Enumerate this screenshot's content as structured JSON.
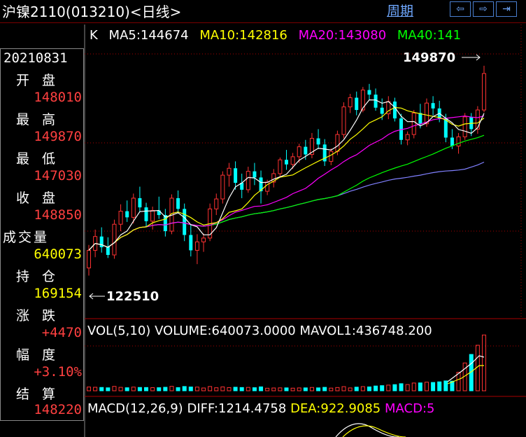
{
  "header": {
    "title": "沪镍2110(013210)<日线>",
    "period_link": "周期",
    "nav_left": "⇦",
    "nav_right": "⇨",
    "nav_end": "⇥"
  },
  "info_panel": {
    "date": "20210831",
    "items": [
      {
        "label": "开盘",
        "value": "148010",
        "color": "#ff4040"
      },
      {
        "label": "最高",
        "value": "149870",
        "color": "#ff4040"
      },
      {
        "label": "最低",
        "value": "147030",
        "color": "#ff4040"
      },
      {
        "label": "收盘",
        "value": "148850",
        "color": "#ff4040"
      },
      {
        "label": "成交量",
        "value": "640073",
        "color": "#ffff00"
      },
      {
        "label": "持仓",
        "value": "169154",
        "color": "#ffff00"
      },
      {
        "label": "涨跌",
        "value": "+4470",
        "color": "#ff4040"
      },
      {
        "label": "幅度",
        "value": "+3.10%",
        "color": "#ff4040"
      },
      {
        "label": "结算",
        "value": "148220",
        "color": "#ff4040"
      }
    ]
  },
  "ma_legend": {
    "k": "K",
    "ma5": "MA5:144674",
    "ma10": "MA10:142816",
    "ma20": "MA20:143080",
    "ma40": "MA40:141",
    "colors": {
      "ma5": "#ffffff",
      "ma10": "#ffff00",
      "ma20": "#ff00ff",
      "ma40": "#00ff00",
      "ma60": "#8080ff"
    }
  },
  "annotations": {
    "high": "149870",
    "low": "122510"
  },
  "volume_legend": {
    "name": "VOL(5,10)",
    "volume": "VOLUME:640073.0000",
    "mavol1": "MAVOL1:436748.200"
  },
  "macd_legend": {
    "name": "MACD(12,26,9)",
    "diff": "DIFF:1214.4758",
    "dea": "DEA:922.9085",
    "macd": "MACD:5"
  },
  "chart_data": {
    "type": "candlestick",
    "price_range": [
      121000,
      151500
    ],
    "candles": [
      [
        123500,
        126500,
        122510,
        125800
      ],
      [
        125800,
        128500,
        124900,
        127600
      ],
      [
        127600,
        128800,
        125500,
        126200
      ],
      [
        126300,
        127500,
        124800,
        125200
      ],
      [
        125200,
        129800,
        124700,
        129200
      ],
      [
        129200,
        131800,
        128300,
        130900
      ],
      [
        130900,
        132300,
        129500,
        130100
      ],
      [
        130100,
        133200,
        129300,
        132600
      ],
      [
        132600,
        134100,
        130800,
        131400
      ],
      [
        131400,
        132000,
        128800,
        129600
      ],
      [
        129600,
        131500,
        128500,
        131000
      ],
      [
        131000,
        132800,
        129900,
        130400
      ],
      [
        130400,
        131200,
        127600,
        128300
      ],
      [
        128300,
        133100,
        127900,
        132600
      ],
      [
        132600,
        133600,
        130600,
        131200
      ],
      [
        131200,
        131900,
        127000,
        127800
      ],
      [
        127800,
        129100,
        125000,
        125800
      ],
      [
        125800,
        127900,
        124000,
        126900
      ],
      [
        126900,
        128000,
        125600,
        127400
      ],
      [
        127400,
        131900,
        127000,
        131200
      ],
      [
        131200,
        133200,
        130400,
        132500
      ],
      [
        132500,
        136100,
        131900,
        135600
      ],
      [
        135600,
        137200,
        134100,
        136500
      ],
      [
        136500,
        137400,
        133700,
        134600
      ],
      [
        134600,
        135800,
        132600,
        133700
      ],
      [
        133700,
        136700,
        133300,
        136100
      ],
      [
        136100,
        137200,
        134300,
        135300
      ],
      [
        135300,
        136200,
        131900,
        133500
      ],
      [
        133500,
        135000,
        133000,
        134700
      ],
      [
        134700,
        136400,
        134000,
        135800
      ],
      [
        135800,
        137900,
        135300,
        137600
      ],
      [
        137600,
        138900,
        136300,
        137000
      ],
      [
        137000,
        138500,
        136400,
        138000
      ],
      [
        138000,
        139700,
        137200,
        139300
      ],
      [
        139300,
        140200,
        137600,
        138300
      ],
      [
        138300,
        141100,
        137800,
        140400
      ],
      [
        140400,
        141600,
        139000,
        139600
      ],
      [
        139600,
        140300,
        136800,
        137400
      ],
      [
        137400,
        139100,
        136900,
        138700
      ],
      [
        138700,
        141400,
        138200,
        140900
      ],
      [
        140900,
        145100,
        140400,
        144500
      ],
      [
        144500,
        146200,
        143700,
        145700
      ],
      [
        145700,
        146500,
        143400,
        144100
      ],
      [
        144100,
        147100,
        143800,
        146700
      ],
      [
        146700,
        147500,
        145400,
        146100
      ],
      [
        146100,
        146900,
        144000,
        144400
      ],
      [
        144400,
        145600,
        142800,
        143600
      ],
      [
        143600,
        145900,
        142900,
        145200
      ],
      [
        145200,
        145700,
        142600,
        143000
      ],
      [
        143000,
        143600,
        139600,
        140200
      ],
      [
        140200,
        141300,
        139500,
        140900
      ],
      [
        140900,
        144100,
        140400,
        143700
      ],
      [
        143700,
        144900,
        141700,
        142300
      ],
      [
        142300,
        145600,
        141900,
        145000
      ],
      [
        145000,
        145900,
        143400,
        144300
      ],
      [
        144300,
        145300,
        142500,
        143000
      ],
      [
        143000,
        143600,
        139900,
        140500
      ],
      [
        140500,
        141600,
        139000,
        139400
      ],
      [
        139400,
        141100,
        138400,
        140600
      ],
      [
        140600,
        143700,
        140200,
        143200
      ],
      [
        143200,
        143700,
        140700,
        141600
      ],
      [
        141600,
        144600,
        141000,
        144100
      ],
      [
        144100,
        149870,
        143800,
        148850
      ]
    ]
  }
}
